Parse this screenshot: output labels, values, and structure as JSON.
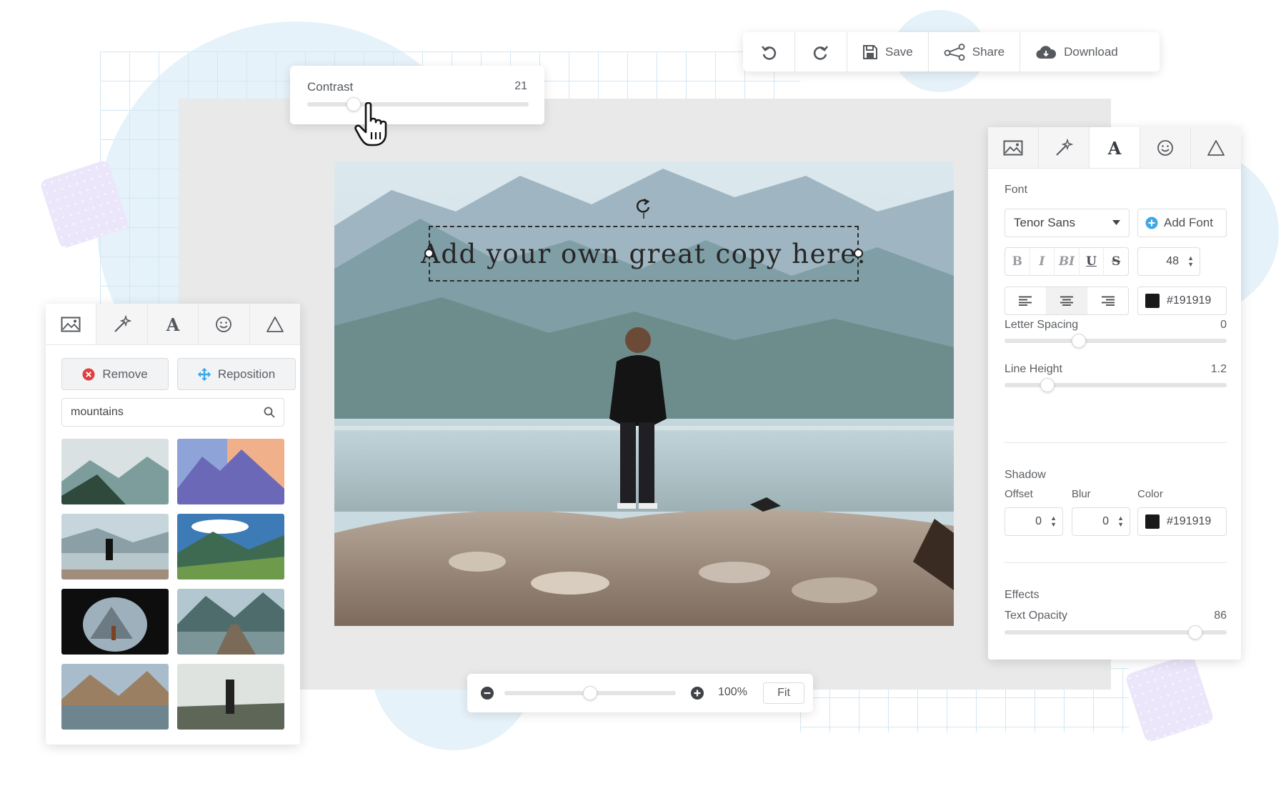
{
  "toolbar": {
    "undo_icon": "undo-icon",
    "redo_icon": "redo-icon",
    "save_label": "Save",
    "share_label": "Share",
    "download_label": "Download"
  },
  "contrast": {
    "label": "Contrast",
    "value": "21",
    "level": 0.21
  },
  "canvas": {
    "text": "Add your own great copy here."
  },
  "left_panel": {
    "tabs": [
      "image-icon",
      "magic-wand-icon",
      "text-icon",
      "smiley-icon",
      "shape-icon"
    ],
    "active_tab": 0,
    "remove_label": "Remove",
    "reposition_label": "Reposition",
    "search_value": "mountains"
  },
  "right_panel": {
    "tabs": [
      "image-icon",
      "magic-wand-icon",
      "text-icon",
      "smiley-icon",
      "shape-icon"
    ],
    "active_tab": 2,
    "font_label": "Font",
    "font_value": "Tenor Sans",
    "add_font_label": "Add Font",
    "styles": [
      "B",
      "I",
      "BI",
      "U",
      "S"
    ],
    "font_size": "48",
    "text_color": "#191919",
    "letter_spacing_label": "Letter Spacing",
    "letter_spacing_value": "0",
    "line_height_label": "Line Height",
    "line_height_value": "1.2",
    "shadow_label": "Shadow",
    "offset_label": "Offset",
    "offset_value": "0",
    "blur_label": "Blur",
    "blur_value": "0",
    "color_label": "Color",
    "shadow_color": "#191919",
    "effects_label": "Effects",
    "opacity_label": "Text Opacity",
    "opacity_value": "86"
  },
  "zoom": {
    "percent": "100%",
    "fit_label": "Fit",
    "level": 0.5
  },
  "colors": {
    "accent_blue": "#3fa7e6",
    "remove_red": "#e0403f",
    "text_dark": "#191919"
  }
}
